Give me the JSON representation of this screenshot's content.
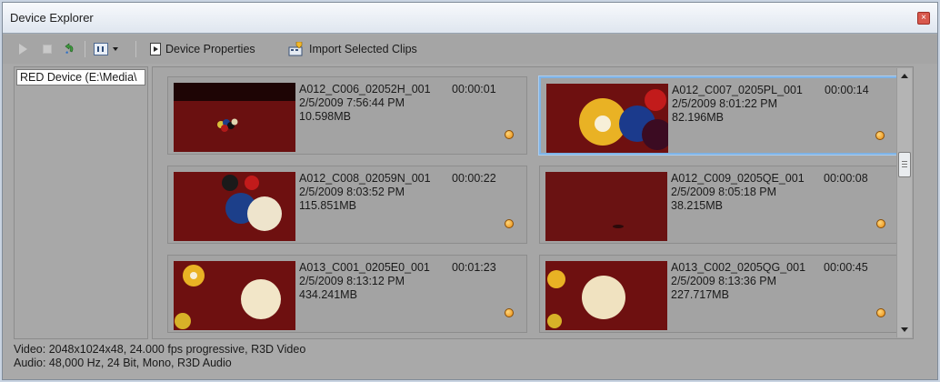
{
  "window": {
    "title": "Device Explorer",
    "close_glyph": "×"
  },
  "toolbar": {
    "play_icon": "play-icon",
    "stop_icon": "stop-icon",
    "refresh_icon": "refresh-icon",
    "view_icon": "view-mode-icon",
    "device_properties_label": "Device Properties",
    "import_selected_label": "Import Selected Clips"
  },
  "tree": {
    "items": [
      {
        "label": "RED Device (E:\\Media\\"
      }
    ]
  },
  "clips": [
    {
      "name": "A012_C006_02052H_001",
      "duration": "00:00:01",
      "date": "2/5/2009 7:56:44 PM",
      "size": "10.598MB",
      "selected": false,
      "thumb": "billiard-balls-far"
    },
    {
      "name": "A012_C007_0205PL_001",
      "duration": "00:00:14",
      "date": "2/5/2009 8:01:22 PM",
      "size": "82.196MB",
      "selected": true,
      "thumb": "billiard-balls-closeup"
    },
    {
      "name": "A012_C008_02059N_001",
      "duration": "00:00:22",
      "date": "2/5/2009 8:03:52 PM",
      "size": "115.851MB",
      "selected": false,
      "thumb": "billiard-cue-ball"
    },
    {
      "name": "A012_C009_0205QE_001",
      "duration": "00:00:08",
      "date": "2/5/2009 8:05:18 PM",
      "size": "38.215MB",
      "selected": false,
      "thumb": "billiard-table-empty"
    },
    {
      "name": "A013_C001_0205E0_001",
      "duration": "00:01:23",
      "date": "2/5/2009 8:13:12 PM",
      "size": "434.241MB",
      "selected": false,
      "thumb": "billiard-cue-ball-yellow"
    },
    {
      "name": "A013_C002_0205QG_001",
      "duration": "00:00:45",
      "date": "2/5/2009 8:13:36 PM",
      "size": "227.717MB",
      "selected": false,
      "thumb": "billiard-cue-ball-near"
    }
  ],
  "colors": {
    "selection_border": "#7fb3e6",
    "status_dot": "#e98b12",
    "felt": "#7a1414"
  },
  "status": {
    "video": "Video: 2048x1024x48, 24.000 fps progressive, R3D Video",
    "audio": "Audio: 48,000 Hz, 24 Bit, Mono, R3D Audio"
  }
}
